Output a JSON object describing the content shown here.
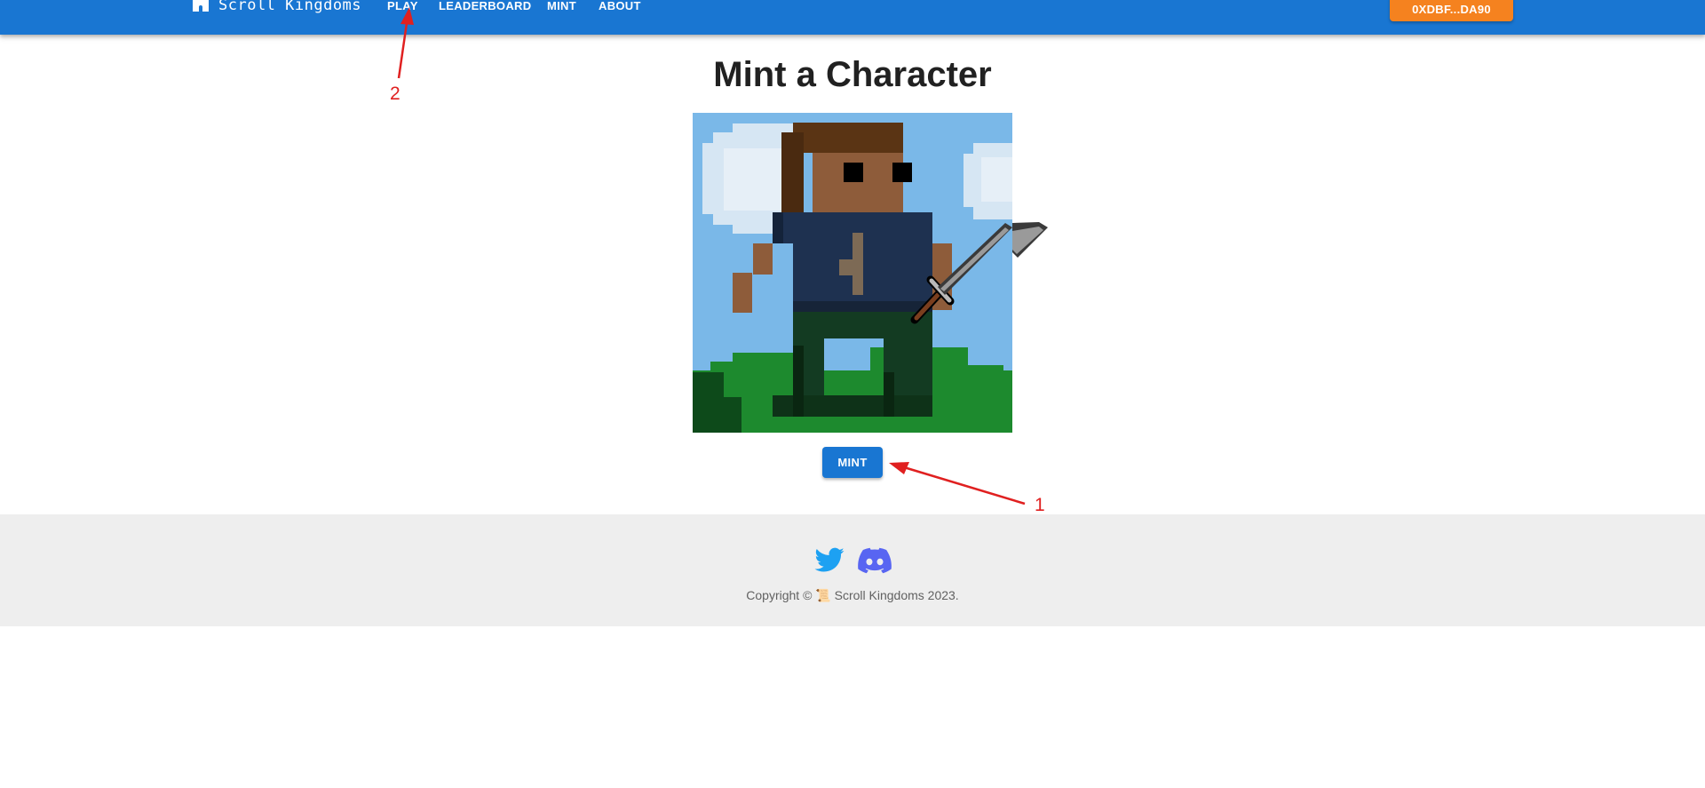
{
  "header": {
    "brand": "Scroll Kingdoms",
    "nav": [
      {
        "label": "PLAY"
      },
      {
        "label": "LEADERBOARD"
      },
      {
        "label": "MINT"
      },
      {
        "label": "ABOUT"
      }
    ],
    "wallet_label": "0XDBF...DA90"
  },
  "main": {
    "title": "Mint a Character",
    "mint_button": "MINT"
  },
  "footer": {
    "copyright": "Copyright © 📜 Scroll Kingdoms 2023."
  },
  "annotations": {
    "marker_1": "1",
    "marker_2": "2"
  },
  "colors": {
    "appbar": "#1976d2",
    "wallet": "#f5821f",
    "annotation": "#e02020",
    "twitter": "#1da1f2",
    "discord": "#5865f2"
  },
  "icons": [
    "castle-icon",
    "twitter-icon",
    "discord-icon"
  ]
}
